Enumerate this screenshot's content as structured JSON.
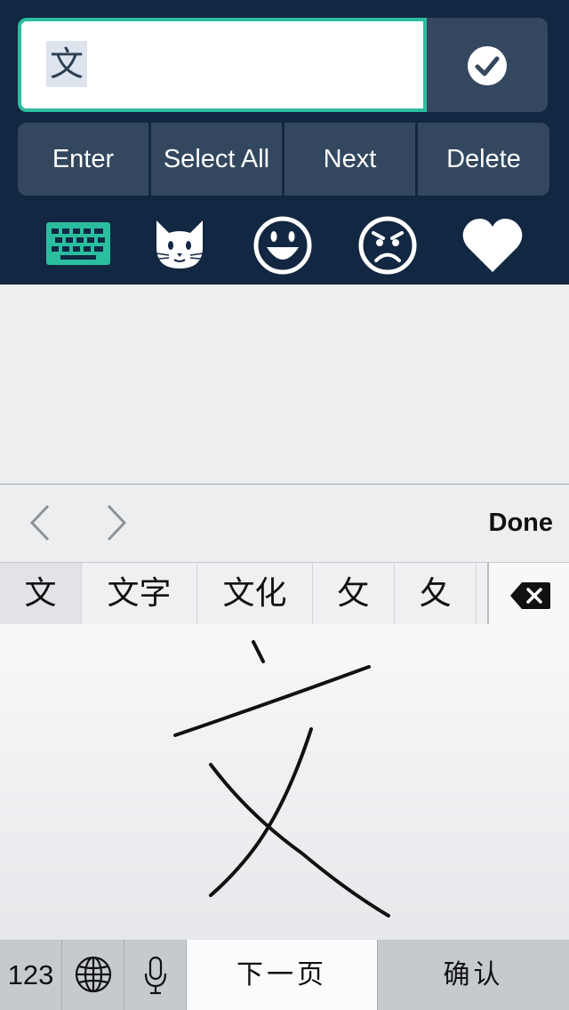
{
  "input": {
    "text": "文"
  },
  "actions": {
    "enter": "Enter",
    "select_all": "Select All",
    "next": "Next",
    "delete": "Delete"
  },
  "tool_icons": [
    "keyboard-icon",
    "cat-face-icon",
    "smile-face-icon",
    "angry-face-icon",
    "heart-icon"
  ],
  "colors": {
    "panel": "#122741",
    "accent": "#2bbd9f",
    "button": "#33475e"
  },
  "keyboard": {
    "done": "Done",
    "candidates": [
      "文",
      "文字",
      "文化",
      "攵",
      "夂"
    ],
    "num_key": "123",
    "next_page": "下一页",
    "confirm": "确认"
  }
}
